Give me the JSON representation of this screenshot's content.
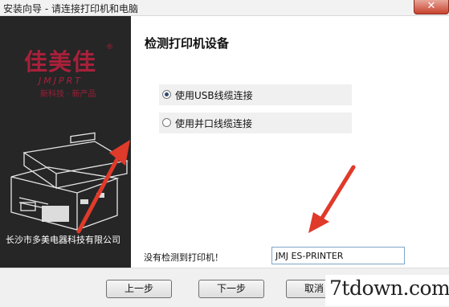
{
  "window": {
    "title": "安装向导 - 请连接打印机和电脑",
    "close_glyph": "✕"
  },
  "banner": {
    "brand_cn": "佳美佳",
    "brand_reg": "®",
    "brand_en": "JMJPRT",
    "slogan": "新科技 · 新产品",
    "company": "长沙市多美电器科技有限公司"
  },
  "main": {
    "heading": "检测打印机设备",
    "options": [
      {
        "label": "使用USB线缆连接",
        "selected": true
      },
      {
        "label": "使用并口线缆连接",
        "selected": false
      }
    ],
    "not_detected_label": "没有检测到打印机！",
    "printer_name": "JMJ ES-PRINTER"
  },
  "buttons": {
    "back": "上一步",
    "next": "下一步",
    "cancel": "取消"
  },
  "watermark": "7tdown.com",
  "colors": {
    "brand": "#a8203a",
    "arrow": "#e03a2a",
    "banner_bg": "#262626"
  },
  "icons": {
    "close": "close-icon",
    "arrows": "red-arrow-icon",
    "printer": "printer-illustration-icon"
  }
}
